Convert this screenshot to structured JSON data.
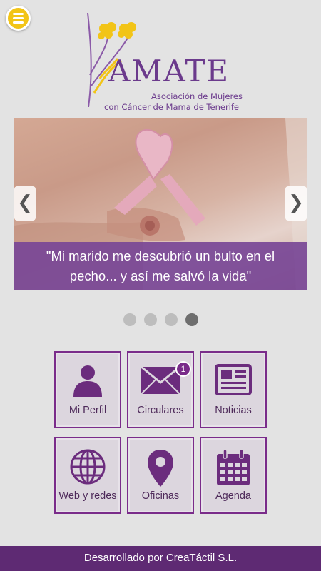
{
  "logo": {
    "name": "AMATE",
    "subtitle_line1": "Asociación de Mujeres",
    "subtitle_line2": "con Cáncer de Mama de Tenerife"
  },
  "slider": {
    "caption_line1": "\"Mi marido me descubrió un bulto en el",
    "caption_line2": "pecho... y así me salvó la vida\"",
    "prev_icon": "chevron-left",
    "next_icon": "chevron-right",
    "slides_total": 4,
    "active_slide": 4
  },
  "tiles": [
    {
      "label": "Mi Perfil",
      "icon": "user-icon"
    },
    {
      "label": "Circulares",
      "icon": "envelope-icon",
      "badge": "1"
    },
    {
      "label": "Noticias",
      "icon": "newspaper-icon"
    },
    {
      "label": "Web y redes",
      "icon": "globe-icon"
    },
    {
      "label": "Oficinas",
      "icon": "map-pin-icon"
    },
    {
      "label": "Agenda",
      "icon": "calendar-icon"
    }
  ],
  "footer": {
    "text": "Desarrollado por CreaTáctil S.L."
  },
  "colors": {
    "accent": "#7a2c8a",
    "menu": "#f2c417",
    "footer": "#5e2a73"
  }
}
